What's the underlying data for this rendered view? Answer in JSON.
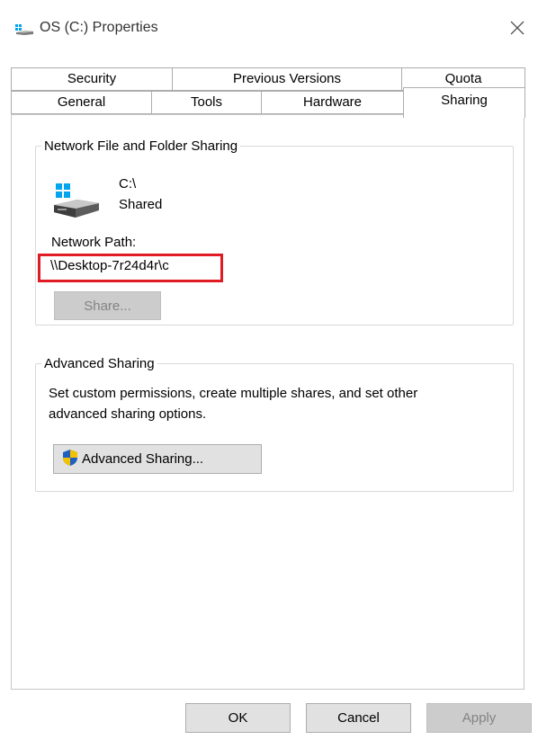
{
  "window": {
    "title": "OS (C:) Properties",
    "close_glyph": "✕"
  },
  "tabs": {
    "row1": [
      {
        "id": "security",
        "label": "Security"
      },
      {
        "id": "previous-versions",
        "label": "Previous Versions"
      },
      {
        "id": "quota",
        "label": "Quota"
      }
    ],
    "row2": [
      {
        "id": "general",
        "label": "General"
      },
      {
        "id": "tools",
        "label": "Tools"
      },
      {
        "id": "hardware",
        "label": "Hardware"
      },
      {
        "id": "sharing",
        "label": "Sharing"
      }
    ],
    "active": "Sharing"
  },
  "network_sharing": {
    "group_title": "Network File and Folder Sharing",
    "drive_path": "C:\\",
    "drive_status": "Shared",
    "network_path_label": "Network Path:",
    "network_path_value": "\\\\Desktop-7r24d4r\\c",
    "share_button": "Share..."
  },
  "advanced_sharing": {
    "group_title": "Advanced Sharing",
    "description_line1": "Set custom permissions, create multiple shares, and set other",
    "description_line2": "advanced sharing options.",
    "button_label": "Advanced Sharing..."
  },
  "footer": {
    "ok": "OK",
    "cancel": "Cancel",
    "apply": "Apply"
  },
  "colors": {
    "highlight": "#e01b24",
    "shield_blue": "#1f5fbf",
    "shield_yellow": "#f2c200",
    "windows_logo": "#00a4ef"
  },
  "icons": {
    "title": "drive-icon",
    "drive": "drive-icon",
    "advanced": "uac-shield-icon",
    "close": "close-icon"
  }
}
